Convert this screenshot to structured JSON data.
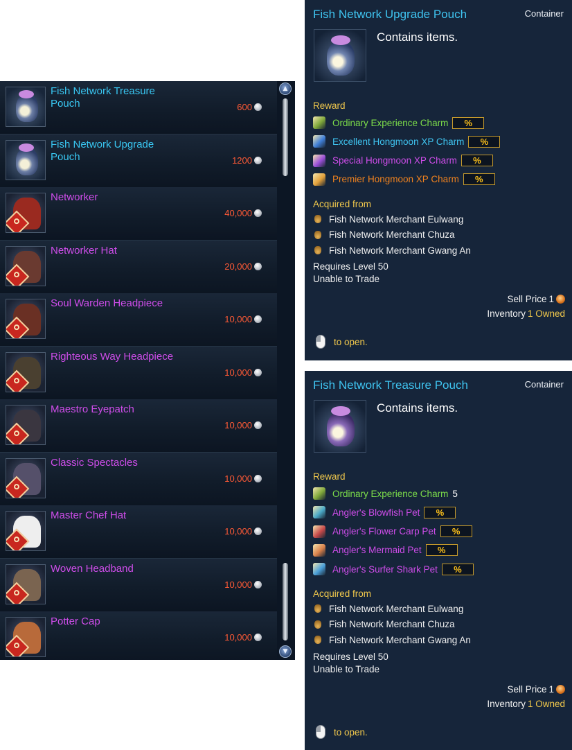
{
  "shop": {
    "items": [
      {
        "name": "Fish Network Treasure Pouch",
        "price": "600",
        "grade": "cyan",
        "icon": "treasure-pouch-icon"
      },
      {
        "name": "Fish Network Upgrade Pouch",
        "price": "1200",
        "grade": "cyan",
        "icon": "upgrade-pouch-icon"
      },
      {
        "name": "Networker",
        "price": "40,000",
        "grade": "purple",
        "icon": "networker-outfit-icon"
      },
      {
        "name": "Networker Hat",
        "price": "20,000",
        "grade": "purple",
        "icon": "networker-hat-icon"
      },
      {
        "name": "Soul Warden Headpiece",
        "price": "10,000",
        "grade": "purple",
        "icon": "soul-warden-headpiece-icon"
      },
      {
        "name": "Righteous Way Headpiece",
        "price": "10,000",
        "grade": "purple",
        "icon": "righteous-way-headpiece-icon"
      },
      {
        "name": "Maestro Eyepatch",
        "price": "10,000",
        "grade": "purple",
        "icon": "maestro-eyepatch-icon"
      },
      {
        "name": "Classic Spectacles",
        "price": "10,000",
        "grade": "purple",
        "icon": "classic-spectacles-icon"
      },
      {
        "name": "Master Chef Hat",
        "price": "10,000",
        "grade": "purple",
        "icon": "master-chef-hat-icon"
      },
      {
        "name": "Woven Headband",
        "price": "10,000",
        "grade": "purple",
        "icon": "woven-headband-icon"
      },
      {
        "name": "Potter Cap",
        "price": "10,000",
        "grade": "purple",
        "icon": "potter-cap-icon"
      }
    ],
    "currency_icon": "silver-coin-icon"
  },
  "tooltips": {
    "upgrade": {
      "title": "Fish Network Upgrade Pouch",
      "category": "Container",
      "description": "Contains items.",
      "reward_heading": "Reward",
      "rewards": [
        {
          "name": "Ordinary Experience Charm",
          "color": "#7dde4a",
          "amount": "%",
          "icon_color": "#7fa83a"
        },
        {
          "name": "Excellent Hongmoon XP Charm",
          "color": "#3fc4f0",
          "amount": "%",
          "icon_color": "#3f7fd9"
        },
        {
          "name": "Special Hongmoon XP Charm",
          "color": "#cf4dea",
          "amount": "%",
          "icon_color": "#9b4fd9"
        },
        {
          "name": "Premier Hongmoon XP Charm",
          "color": "#f0821e",
          "amount": "%",
          "icon_color": "#e2a03a"
        }
      ],
      "acquired_heading": "Acquired from",
      "sources": [
        "Fish Network Merchant Eulwang",
        "Fish Network Merchant Chuza",
        "Fish Network Merchant Gwang An"
      ],
      "requires_level": "Requires Level 50",
      "trade": "Unable to Trade",
      "sell_price_label": "Sell Price",
      "sell_price_value": "1",
      "inventory_label": "Inventory",
      "inventory_value": "1 Owned",
      "open_hint": "to open."
    },
    "treasure": {
      "title": "Fish Network Treasure Pouch",
      "category": "Container",
      "description": "Contains items.",
      "reward_heading": "Reward",
      "rewards": [
        {
          "name": "Ordinary Experience Charm",
          "color": "#7dde4a",
          "amount": "5",
          "icon_color": "#7fa83a"
        },
        {
          "name": "Angler's Blowfish Pet",
          "color": "#cf4dea",
          "amount": "%",
          "icon_color": "#4aa9c8"
        },
        {
          "name": "Angler's Flower Carp Pet",
          "color": "#cf4dea",
          "amount": "%",
          "icon_color": "#c84a4a"
        },
        {
          "name": "Angler's Mermaid Pet",
          "color": "#cf4dea",
          "amount": "%",
          "icon_color": "#d9804a"
        },
        {
          "name": "Angler's Surfer Shark Pet",
          "color": "#cf4dea",
          "amount": "%",
          "icon_color": "#4a9fd9"
        }
      ],
      "acquired_heading": "Acquired from",
      "sources": [
        "Fish Network Merchant Eulwang",
        "Fish Network Merchant Chuza",
        "Fish Network Merchant Gwang An"
      ],
      "requires_level": "Requires Level 50",
      "trade": "Unable to Trade",
      "sell_price_label": "Sell Price",
      "sell_price_value": "1",
      "inventory_label": "Inventory",
      "inventory_value": "1 Owned",
      "open_hint": "to open."
    }
  },
  "colors": {
    "cyan_grade": "#39c7f2",
    "purple_grade": "#cf4dea",
    "price": "#ff5a36",
    "section": "#f2c94c",
    "panel": "#16253a"
  }
}
